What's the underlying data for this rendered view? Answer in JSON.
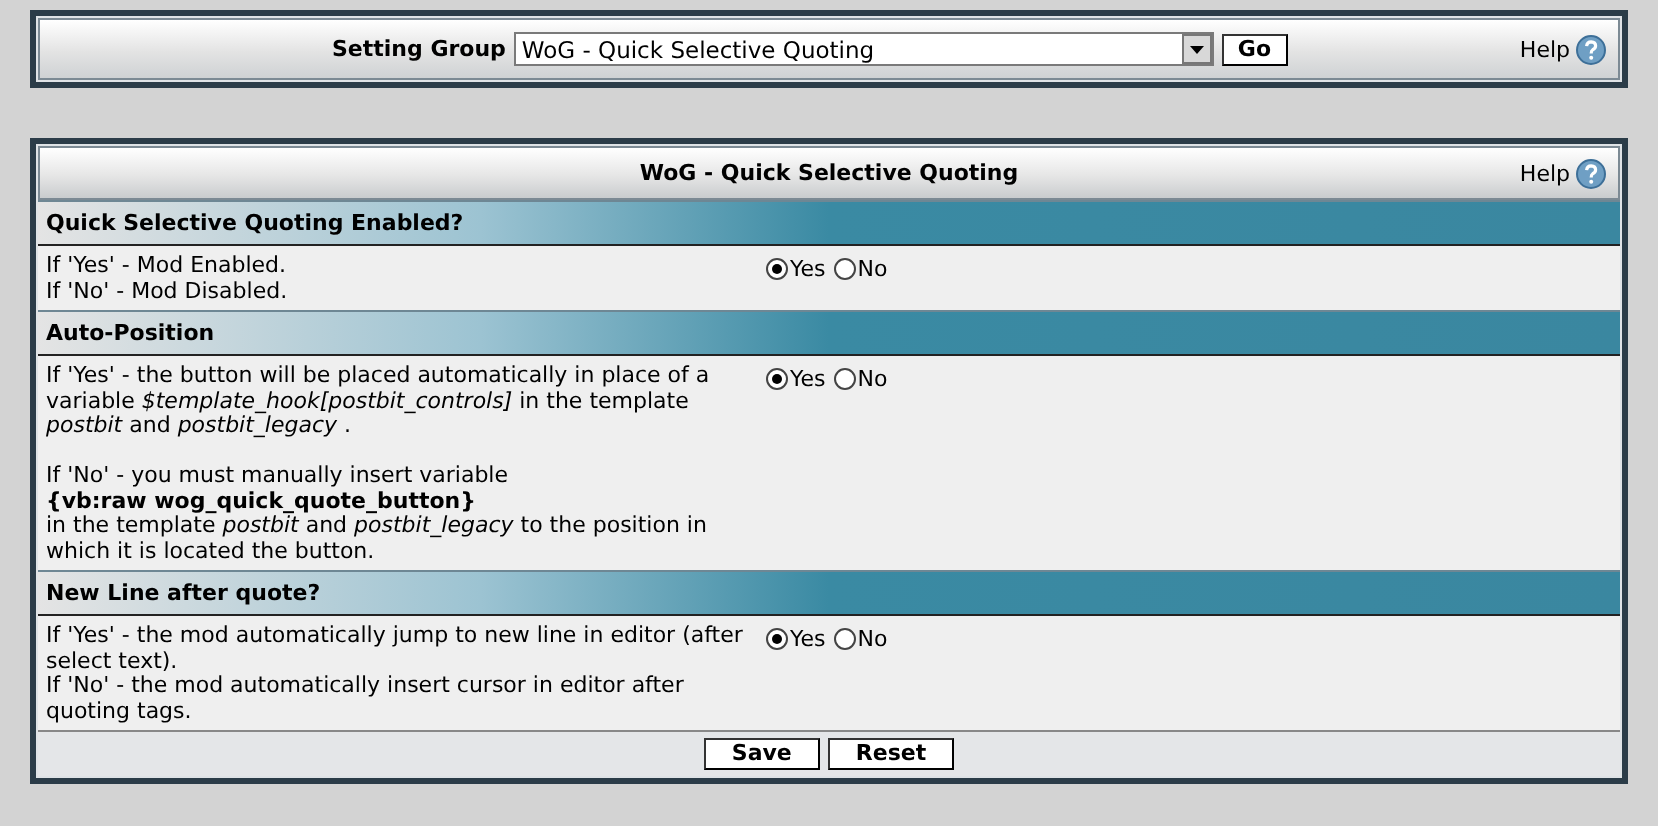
{
  "setting_group": {
    "label": "Setting Group",
    "value": "WoG - Quick Selective Quoting",
    "go": "Go",
    "help": "Help"
  },
  "panel": {
    "title": "WoG - Quick Selective Quoting",
    "help": "Help",
    "settings": [
      {
        "title": "Quick Selective Quoting Enabled?",
        "paragraphs": [
          [
            "If 'Yes' - Mod Enabled.",
            "If 'No' - Mod Disabled."
          ]
        ],
        "options": [
          {
            "label": "Yes",
            "selected": true
          },
          {
            "label": "No",
            "selected": false
          }
        ]
      },
      {
        "title": "Auto-Position",
        "paragraphs": [
          [
            "If 'Yes' - the button will be placed automatically in place of a variable *$template_hook[postbit_controls]* in the template *postbit* and *postbit_legacy* ."
          ],
          [
            "If 'No' - you must manually insert variable",
            "**{vb:raw wog_quick_quote_button}**",
            "in the template *postbit* and *postbit_legacy* to the position in which it is located the button."
          ]
        ],
        "options": [
          {
            "label": "Yes",
            "selected": true
          },
          {
            "label": "No",
            "selected": false
          }
        ]
      },
      {
        "title": "New Line after quote?",
        "paragraphs": [
          [
            "If 'Yes' - the mod automatically jump to new line in editor (after select text).",
            "If 'No' - the mod automatically insert cursor in editor after quoting tags."
          ]
        ],
        "options": [
          {
            "label": "Yes",
            "selected": true
          },
          {
            "label": "No",
            "selected": false
          }
        ]
      }
    ],
    "buttons": [
      "Save",
      "Reset"
    ]
  }
}
